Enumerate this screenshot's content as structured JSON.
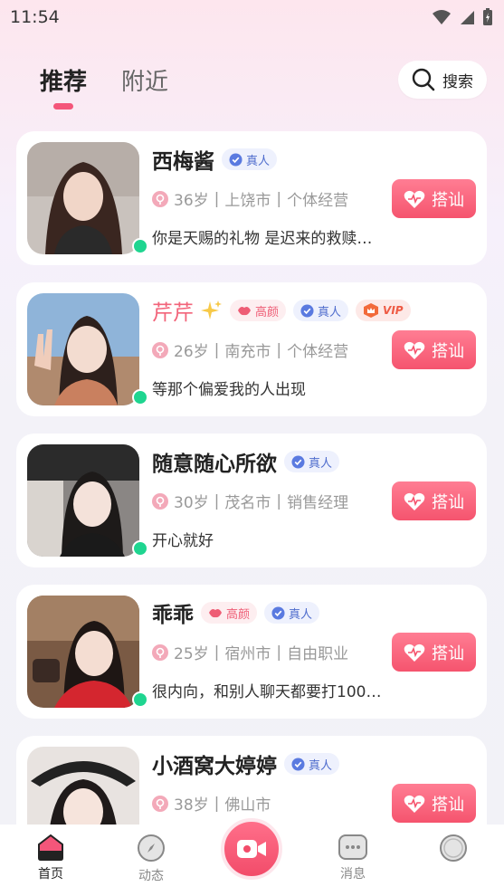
{
  "status_bar": {
    "time": "11:54"
  },
  "tabs": [
    {
      "label": "推荐",
      "active": true
    },
    {
      "label": "附近",
      "active": false
    }
  ],
  "search": {
    "label": "搜索"
  },
  "profiles": [
    {
      "name": "西梅酱",
      "badges": [
        "真人"
      ],
      "age": "36岁",
      "city": "上饶市",
      "job": "个体经营",
      "bio": "你是天赐的礼物 是迟来的救赎…",
      "online": true,
      "button": "搭讪"
    },
    {
      "name": "芹芹",
      "badges": [
        "高颜",
        "真人",
        "VIP"
      ],
      "age": "26岁",
      "city": "南充市",
      "job": "个体经营",
      "bio": "等那个偏爱我的人出现",
      "online": true,
      "button": "搭讪"
    },
    {
      "name": "随意随心所欲",
      "badges": [
        "真人"
      ],
      "age": "30岁",
      "city": "茂名市",
      "job": "销售经理",
      "bio": "开心就好",
      "online": true,
      "button": "搭讪"
    },
    {
      "name": "乖乖",
      "badges": [
        "高颜",
        "真人"
      ],
      "age": "25岁",
      "city": "宿州市",
      "job": "自由职业",
      "bio": "很内向，和别人聊天都要打100…",
      "online": true,
      "button": "搭讪"
    },
    {
      "name": "小酒窝大婷婷",
      "badges": [
        "真人"
      ],
      "age": "38岁",
      "city": "佛山市",
      "job": "",
      "bio": "",
      "online": false,
      "button": "搭讪"
    }
  ],
  "bottom_nav": [
    {
      "label": "首页",
      "icon": "home-icon",
      "active": true
    },
    {
      "label": "动态",
      "icon": "compass-icon",
      "active": false
    },
    {
      "label": "",
      "icon": "video-camera-icon",
      "active": false
    },
    {
      "label": "消息",
      "icon": "message-icon",
      "active": false
    },
    {
      "label": "",
      "icon": "profile-icon",
      "active": false
    }
  ],
  "colors": {
    "accent": "#f4567a",
    "online": "#1fd590",
    "real_badge": "#4e6ccd"
  }
}
